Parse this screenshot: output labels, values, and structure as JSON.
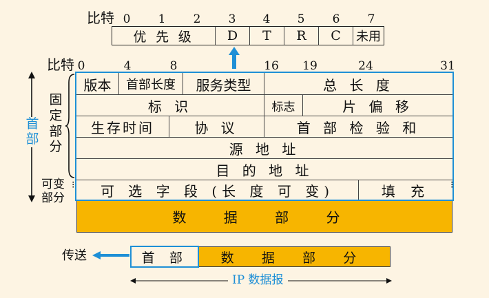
{
  "tos": {
    "bit_label": "比特",
    "ticks": [
      "0",
      "1",
      "2",
      "3",
      "4",
      "5",
      "6",
      "7"
    ],
    "fields": [
      "优 先 级",
      "D",
      "T",
      "R",
      "C",
      "未用"
    ]
  },
  "header": {
    "bit_label": "比特",
    "ticks": [
      "0",
      "4",
      "8",
      "16",
      "19",
      "24",
      "31"
    ],
    "rows": [
      [
        "版本",
        "首部长度",
        "服务类型",
        "总 长 度"
      ],
      [
        "标 识",
        "标志",
        "片 偏 移"
      ],
      [
        "生存时间",
        "协 议",
        "首 部 检 验 和"
      ],
      [
        "源 地 址"
      ],
      [
        "目 的 地 址"
      ],
      [
        "可 选 字 段 (长 度 可 变)",
        "填 充"
      ]
    ]
  },
  "side_labels": {
    "header_vertical": [
      "首",
      "部"
    ],
    "fixed_part": [
      "固",
      "定",
      "部",
      "分"
    ],
    "variable_part": [
      "可变",
      "部分"
    ]
  },
  "data_part_label": "数 据 部 分",
  "bottom": {
    "send_label": "传送",
    "header_label": "首 部",
    "data_label": "数 据 部 分",
    "datagram_label": "IP 数据报"
  },
  "colors": {
    "accent_blue": "#1e8fd6",
    "data_gold": "#f7b500",
    "background": "#fdf4e3"
  }
}
